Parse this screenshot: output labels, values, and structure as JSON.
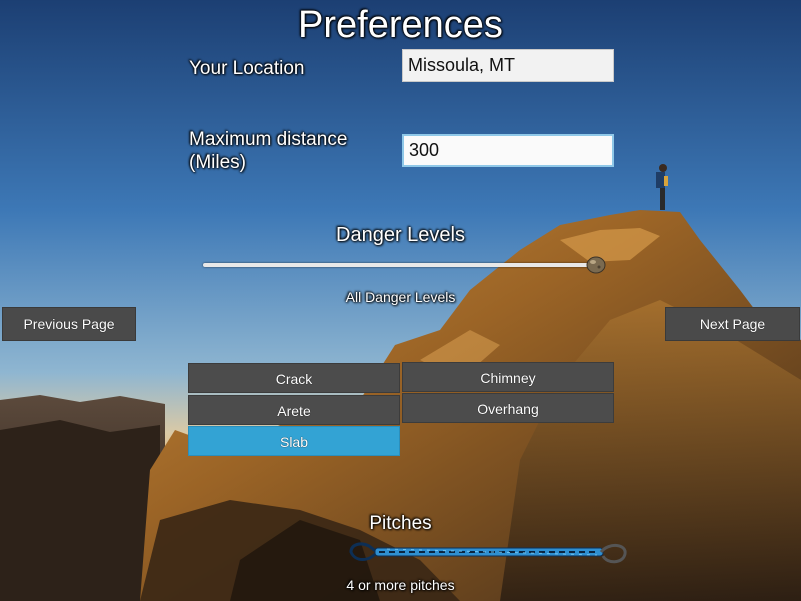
{
  "title": "Preferences",
  "location": {
    "label": "Your Location",
    "value": "Missoula, MT"
  },
  "distance": {
    "label_line1": "Maximum distance",
    "label_line2": "(Miles)",
    "value": "300"
  },
  "danger": {
    "label": "Danger Levels",
    "value_text": "All Danger Levels",
    "level": 1.0
  },
  "nav": {
    "previous": "Previous Page",
    "next": "Next Page"
  },
  "climb_types": {
    "crack": "Crack",
    "chimney": "Chimney",
    "arete": "Arete",
    "overhang": "Overhang",
    "slab": "Slab",
    "selected": "Slab",
    "selected_color": "#33a3d4"
  },
  "pitches": {
    "label": "Pitches",
    "value_text": "4 or more pitches",
    "rope_color": "#2f8fd0"
  }
}
